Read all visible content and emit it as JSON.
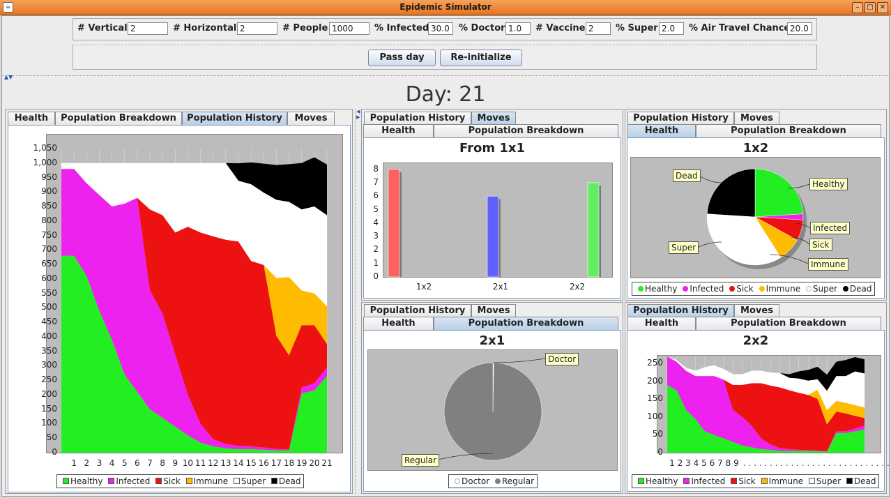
{
  "window": {
    "title": "Epidemic Simulator",
    "icon": "app-icon"
  },
  "params": [
    {
      "label": "# Vertical",
      "value": "2"
    },
    {
      "label": "# Horizontal",
      "value": "2"
    },
    {
      "label": "# People",
      "value": "1000"
    },
    {
      "label": "% Infected",
      "value": "30.0"
    },
    {
      "label": "% Doctor",
      "value": "1.0"
    },
    {
      "label": "# Vaccine",
      "value": "2"
    },
    {
      "label": "% Super",
      "value": "2.0"
    },
    {
      "label": "% Air Travel Chance",
      "value": "20.0"
    }
  ],
  "buttons": {
    "pass_day": "Pass day",
    "reinit": "Re-initialize"
  },
  "day_label": "Day: 21",
  "tabs": {
    "health": "Health",
    "breakdown": "Population Breakdown",
    "history": "Population History",
    "moves": "Moves"
  },
  "legend": {
    "healthy": "Healthy",
    "infected": "Infected",
    "sick": "Sick",
    "immune": "Immune",
    "super": "Super",
    "dead": "Dead",
    "doctor": "Doctor",
    "regular": "Regular"
  },
  "colors": {
    "healthy": "#22ee22",
    "infected": "#ee22ee",
    "sick": "#ee1111",
    "immune": "#ffbb00",
    "super": "#ffffff",
    "dead": "#000000",
    "regular": "#808080"
  },
  "chart_data": [
    {
      "id": "left-history",
      "type": "area",
      "stacked": true,
      "series_order": [
        "healthy",
        "infected",
        "sick",
        "immune",
        "super",
        "dead"
      ],
      "x": [
        0,
        1,
        2,
        3,
        4,
        5,
        6,
        7,
        8,
        9,
        10,
        11,
        12,
        13,
        14,
        15,
        16,
        17,
        18,
        19,
        20,
        21
      ],
      "y_ticks": [
        0,
        50,
        100,
        150,
        200,
        250,
        300,
        350,
        400,
        450,
        500,
        550,
        600,
        650,
        700,
        750,
        800,
        850,
        900,
        950,
        1000,
        1050
      ],
      "y_labels": [
        "0",
        "50",
        "100",
        "150",
        "200",
        "250",
        "300",
        "350",
        "400",
        "450",
        "500",
        "550",
        "600",
        "650",
        "700",
        "750",
        "800",
        "850",
        "900",
        "950",
        "1,000",
        "1,050"
      ],
      "x_labels": [
        "1",
        "2",
        "3",
        "4",
        "5",
        "6",
        "7",
        "8",
        "9",
        "10",
        "11",
        "12",
        "13",
        "14",
        "15",
        "16",
        "17",
        "18",
        "19",
        "20",
        "21"
      ],
      "ylim": [
        0,
        1050
      ],
      "series": {
        "healthy": [
          680,
          680,
          610,
          490,
          390,
          270,
          210,
          150,
          120,
          90,
          60,
          35,
          22,
          15,
          12,
          12,
          10,
          8,
          8,
          205,
          215,
          265
        ],
        "infected": [
          300,
          300,
          320,
          400,
          460,
          590,
          670,
          410,
          360,
          250,
          140,
          65,
          25,
          15,
          12,
          10,
          8,
          5,
          3,
          20,
          25,
          30
        ],
        "sick": [
          0,
          0,
          0,
          0,
          0,
          0,
          0,
          280,
          340,
          420,
          580,
          660,
          700,
          705,
          705,
          640,
          630,
          390,
          325,
          215,
          200,
          80
        ],
        "immune": [
          0,
          0,
          0,
          0,
          0,
          0,
          0,
          0,
          0,
          0,
          0,
          0,
          0,
          0,
          0,
          0,
          0,
          200,
          270,
          120,
          110,
          130
        ],
        "super": [
          20,
          20,
          70,
          110,
          150,
          140,
          120,
          160,
          180,
          240,
          220,
          240,
          253,
          265,
          210,
          265,
          250,
          270,
          260,
          280,
          300,
          315
        ],
        "dead": [
          0,
          0,
          0,
          0,
          0,
          0,
          0,
          0,
          0,
          0,
          0,
          0,
          0,
          0,
          60,
          75,
          100,
          120,
          130,
          160,
          170,
          175
        ]
      }
    },
    {
      "id": "moves-1x1",
      "type": "bar",
      "title": "From 1x1",
      "categories": [
        "1x2",
        "2x1",
        "2x2"
      ],
      "values": [
        8,
        6,
        7
      ],
      "colors": [
        "#ff6060",
        "#6060ff",
        "#60ee60"
      ],
      "ylim": [
        0,
        8.5
      ],
      "y_ticks": [
        0,
        1,
        2,
        3,
        4,
        5,
        6,
        7,
        8
      ],
      "y_labels": [
        "0",
        "1",
        "2",
        "3",
        "4",
        "5",
        "6",
        "7",
        "8"
      ]
    },
    {
      "id": "health-1x2",
      "type": "pie",
      "title": "1x2",
      "slices": [
        {
          "key": "healthy",
          "label": "Healthy",
          "value": 24
        },
        {
          "key": "infected",
          "label": "Infected",
          "value": 2
        },
        {
          "key": "sick",
          "label": "Sick",
          "value": 7
        },
        {
          "key": "immune",
          "label": "Immune",
          "value": 8
        },
        {
          "key": "super",
          "label": "Super",
          "value": 35
        },
        {
          "key": "dead",
          "label": "Dead",
          "value": 24
        }
      ]
    },
    {
      "id": "breakdown-2x1",
      "type": "pie",
      "title": "2x1",
      "slices": [
        {
          "key": "doctor",
          "label": "Doctor",
          "value": 0.3
        },
        {
          "key": "regular",
          "label": "Regular",
          "value": 99.7
        }
      ]
    },
    {
      "id": "history-2x2",
      "type": "area",
      "stacked": true,
      "title": "2x2",
      "series_order": [
        "healthy",
        "infected",
        "sick",
        "immune",
        "super",
        "dead"
      ],
      "x": [
        0,
        1,
        2,
        3,
        4,
        5,
        6,
        7,
        8,
        9,
        10,
        11,
        12,
        13,
        14,
        15,
        16,
        17,
        18,
        19,
        20,
        21
      ],
      "y_ticks": [
        0,
        50,
        100,
        150,
        200,
        250
      ],
      "y_labels": [
        "0",
        "50",
        "100",
        "150",
        "200",
        "250"
      ],
      "x_labels": [
        "1",
        "2",
        "3",
        "4",
        "5",
        "6",
        "7",
        "8",
        "9"
      ],
      "ylim": [
        0,
        270
      ],
      "series": {
        "healthy": [
          190,
          175,
          120,
          95,
          60,
          50,
          40,
          30,
          20,
          15,
          10,
          8,
          5,
          5,
          5,
          5,
          4,
          3,
          55,
          55,
          60,
          65
        ],
        "infected": [
          80,
          80,
          110,
          120,
          155,
          165,
          165,
          90,
          80,
          60,
          30,
          15,
          8,
          5,
          3,
          2,
          2,
          1,
          5,
          5,
          8,
          12
        ],
        "sick": [
          0,
          0,
          0,
          0,
          0,
          0,
          0,
          70,
          90,
          120,
          155,
          165,
          170,
          165,
          160,
          155,
          145,
          75,
          55,
          50,
          35,
          20
        ],
        "immune": [
          0,
          0,
          0,
          0,
          0,
          0,
          0,
          0,
          0,
          0,
          0,
          0,
          0,
          0,
          0,
          0,
          25,
          40,
          30,
          30,
          30,
          30
        ],
        "super": [
          0,
          5,
          8,
          15,
          25,
          30,
          30,
          30,
          30,
          35,
          35,
          37,
          40,
          35,
          40,
          40,
          30,
          55,
          70,
          75,
          95,
          95
        ],
        "dead": [
          0,
          0,
          0,
          0,
          0,
          0,
          0,
          0,
          0,
          0,
          0,
          0,
          0,
          10,
          20,
          30,
          35,
          45,
          40,
          45,
          40,
          40
        ]
      }
    }
  ]
}
